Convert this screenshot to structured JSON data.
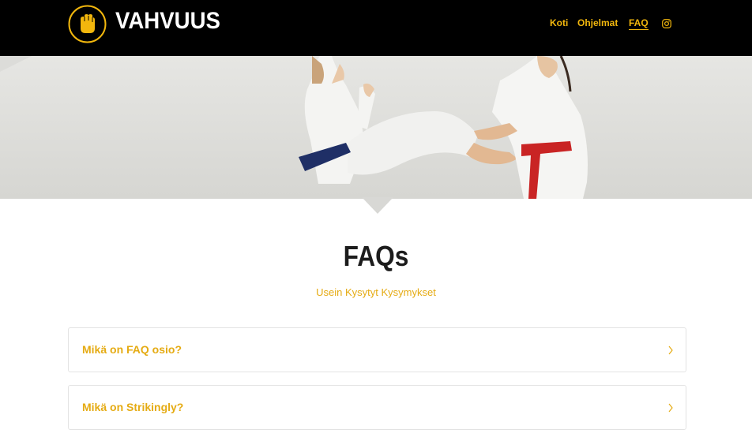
{
  "header": {
    "brand": "VAHVUUS",
    "logo_icon": "raised-fist-icon",
    "nav": [
      {
        "label": "Koti",
        "active": false
      },
      {
        "label": "Ohjelmat",
        "active": false
      },
      {
        "label": "FAQ",
        "active": true
      }
    ],
    "social_icon": "instagram-icon"
  },
  "hero": {
    "image": "two-martial-artists-sparring-photo"
  },
  "main": {
    "title": "FAQs",
    "subtitle": "Usein Kysytyt Kysymykset",
    "faqs": [
      {
        "question": "Mikä on FAQ osio?",
        "icon": "chevron-right-icon"
      },
      {
        "question": "Mikä on Strikingly?",
        "icon": "chevron-right-icon"
      }
    ]
  },
  "colors": {
    "accent": "#f2b70d",
    "header_bg": "#000000",
    "title_text": "#1c1c1c",
    "red_belt": "#c92424",
    "blue_belt": "#1f2f66"
  }
}
